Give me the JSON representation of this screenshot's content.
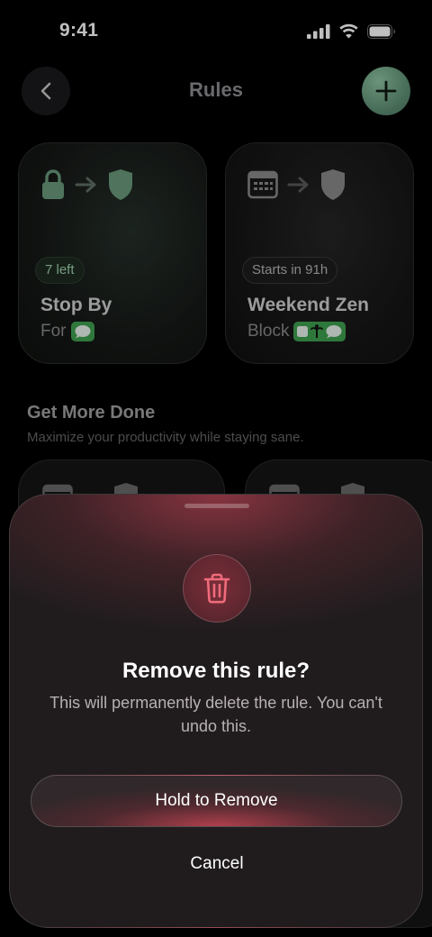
{
  "status_bar": {
    "time": "9:41"
  },
  "nav": {
    "title": "Rules"
  },
  "rules": [
    {
      "badge": "7 left",
      "name": "Stop By",
      "sub": "For"
    },
    {
      "badge": "Starts in 91h",
      "name": "Weekend Zen",
      "sub": "Block"
    }
  ],
  "section": {
    "title": "Get More Done",
    "subtitle": "Maximize your productivity while staying sane."
  },
  "sheet": {
    "title": "Remove this rule?",
    "body": "This will permanently delete the rule. You can't undo this.",
    "hold_label": "Hold to Remove",
    "cancel_label": "Cancel"
  },
  "colors": {
    "accent_green": "#8fc4a3",
    "destructive": "#e8606f"
  }
}
